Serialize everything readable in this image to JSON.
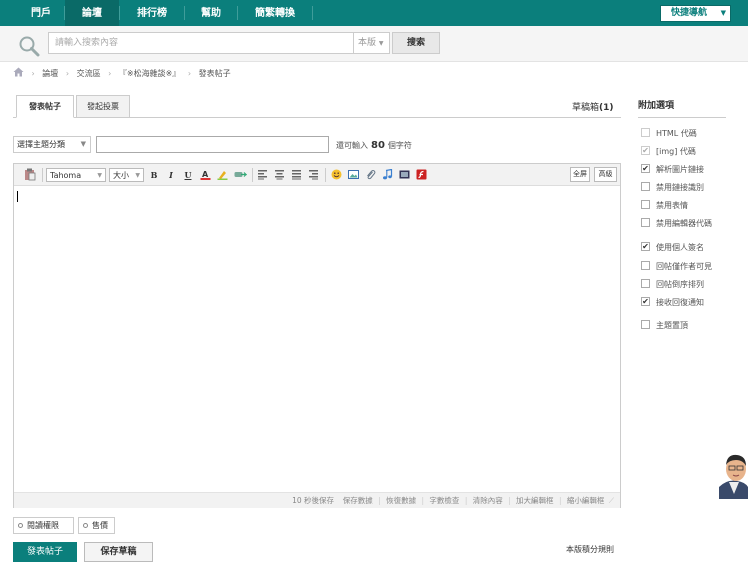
{
  "nav": {
    "items": [
      "門戶",
      "論壇",
      "排行榜",
      "幫助",
      "簡繁轉換"
    ],
    "quick_nav": "快捷導航"
  },
  "search": {
    "placeholder": "請輸入搜索內容",
    "scope": "本版",
    "button": "搜索"
  },
  "breadcrumb": [
    "論壇",
    "交流區",
    "『※松海雜談※』",
    "發表帖子"
  ],
  "tabs": [
    "發表帖子",
    "發起投票"
  ],
  "drafts": {
    "label": "草稿箱",
    "count": "(1)"
  },
  "form": {
    "category": "選擇主題分類",
    "remain_prefix": "還可輸入",
    "remain_count": "80",
    "remain_suffix": "個字符"
  },
  "editor": {
    "font": "Tahoma",
    "size": "大小",
    "fullscreen": "全屏",
    "advanced": "高級",
    "status": [
      "10 秒後保存",
      "保存數據",
      "恢復數據",
      "字數檢查",
      "清除內容",
      "加大編輯框",
      "縮小編輯框"
    ]
  },
  "options": {
    "permission": "閱讀權限",
    "reward": "售價"
  },
  "actions": {
    "submit": "發表帖子",
    "save_draft": "保存草稿",
    "rules": "本版積分規則"
  },
  "side": {
    "title": "附加選項",
    "options": [
      {
        "label": "HTML 代碼",
        "checked": false,
        "disabled": true
      },
      {
        "label": "[img] 代碼",
        "checked": true,
        "disabled": true
      },
      {
        "label": "解析圖片鏈接",
        "checked": true,
        "disabled": false
      },
      {
        "label": "禁用鏈接識別",
        "checked": false,
        "disabled": false
      },
      {
        "label": "禁用表情",
        "checked": false,
        "disabled": false
      },
      {
        "label": "禁用編輯器代碼",
        "checked": false,
        "disabled": false
      },
      {
        "label": "使用個人簽名",
        "checked": true,
        "disabled": false
      },
      {
        "label": "回帖僅作者可見",
        "checked": false,
        "disabled": false
      },
      {
        "label": "回帖倒序排列",
        "checked": false,
        "disabled": false
      },
      {
        "label": "接收回復通知",
        "checked": true,
        "disabled": false
      },
      {
        "label": "主題置頂",
        "checked": false,
        "disabled": false
      }
    ]
  },
  "colors": {
    "brand": "#0b7f7c",
    "brand_dark": "#0a6a67"
  }
}
